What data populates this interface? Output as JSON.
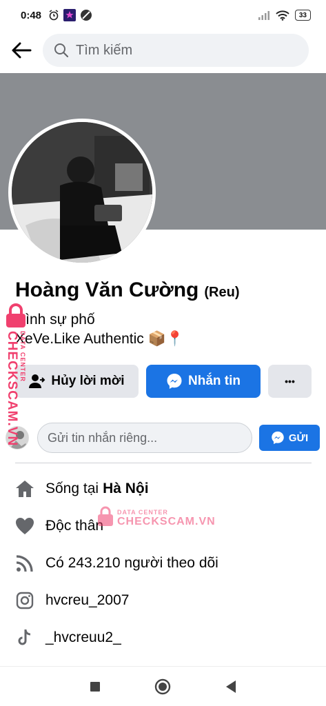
{
  "status_bar": {
    "time": "0:48",
    "battery": "33",
    "icons": [
      "alarm-icon",
      "app-icon",
      "no-entry-icon",
      "signal-icon",
      "wifi-icon",
      "battery-icon"
    ]
  },
  "search": {
    "placeholder": "Tìm kiếm"
  },
  "profile": {
    "name": "Hoàng Văn Cường",
    "nickname": "(Reu)",
    "bio_line1": "Hình sự phố",
    "bio_line2": "XeVe.Like Authentic 📦📍"
  },
  "actions": {
    "cancel_request": "Hủy lời mời",
    "message": "Nhắn tin",
    "more": "•••"
  },
  "private_message": {
    "placeholder": "Gửi tin nhắn riêng...",
    "send_label": "GỬI"
  },
  "details": {
    "lives_prefix": "Sống tại",
    "lives_city": "Hà Nội",
    "relationship": "Độc thân",
    "followers": "Có 243.210 người theo dõi",
    "instagram": "hvcreu_2007",
    "tiktok": "_hvcreuu2_"
  },
  "watermark": {
    "side_text": "CHECKSCAM.VN",
    "side_sub": "DATA CENTER",
    "center_sub": "DATA CENTER",
    "center_main": "CHECKSCAM.VN"
  },
  "colors": {
    "accent": "#1b74e4",
    "cover": "#8a8d91",
    "watermark": "#f0406e"
  }
}
